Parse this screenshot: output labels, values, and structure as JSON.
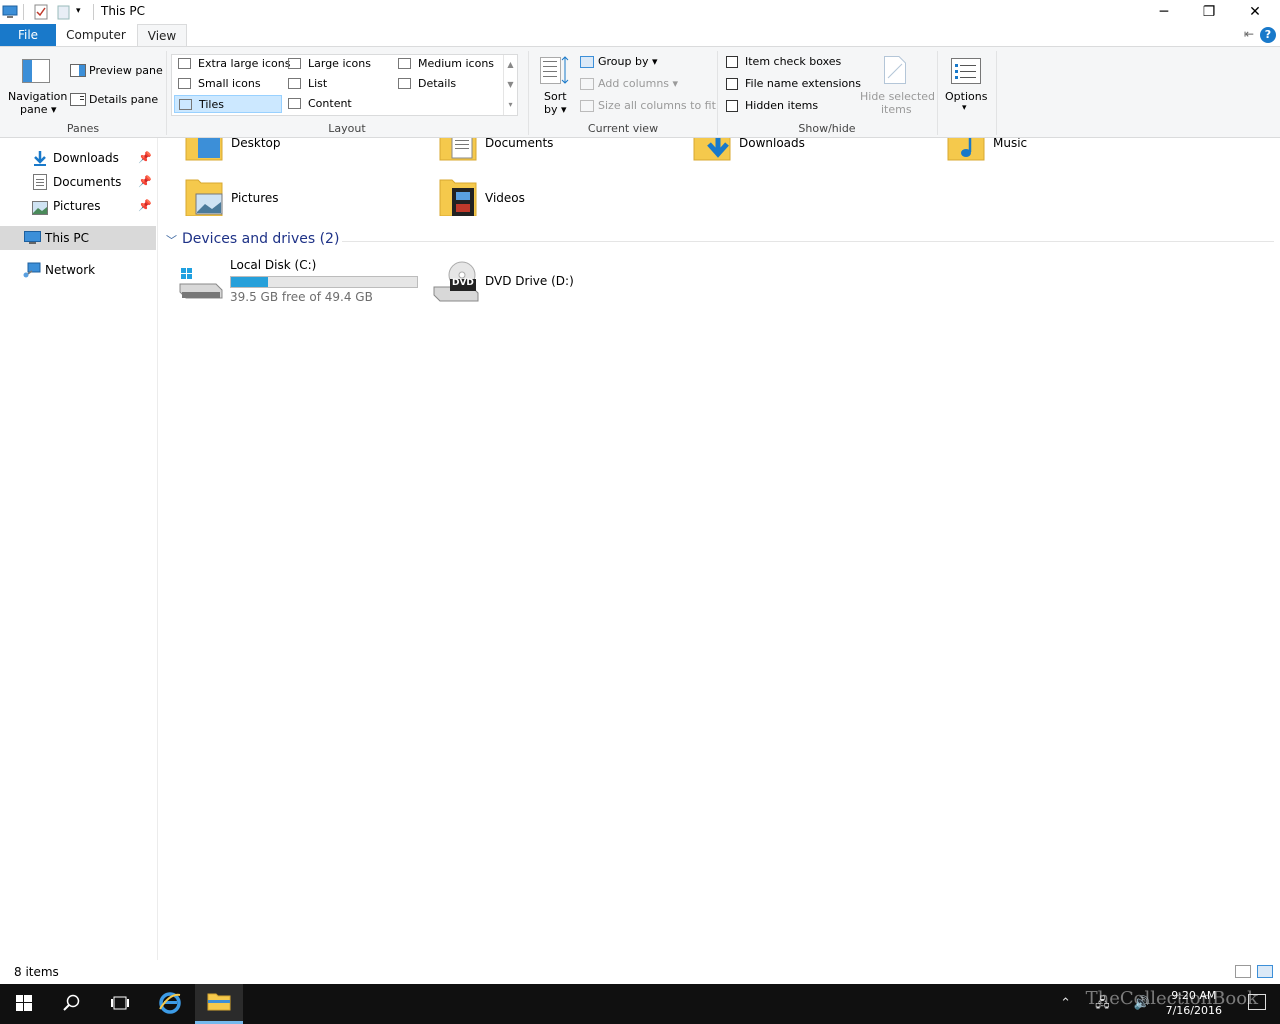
{
  "window": {
    "title": "This PC",
    "controls": {
      "minimize": "─",
      "maximize": "❐",
      "close": "✕"
    }
  },
  "tabs": [
    {
      "label": "File"
    },
    {
      "label": "Computer"
    },
    {
      "label": "View"
    }
  ],
  "ribbon": {
    "panes": {
      "navigation_pane": "Navigation",
      "navigation_pane2": "pane ▾",
      "preview_pane": "Preview pane",
      "details_pane": "Details pane",
      "group_label": "Panes"
    },
    "layout": {
      "items": [
        {
          "label": "Extra large icons"
        },
        {
          "label": "Large icons"
        },
        {
          "label": "Medium icons"
        },
        {
          "label": "Small icons"
        },
        {
          "label": "List"
        },
        {
          "label": "Details"
        },
        {
          "label": "Tiles"
        },
        {
          "label": "Content"
        }
      ],
      "selected": "Tiles",
      "group_label": "Layout"
    },
    "current_view": {
      "sort_by": "Sort",
      "sort_by2": "by ▾",
      "group_by": "Group by ▾",
      "add_columns": "Add columns ▾",
      "size_columns": "Size all columns to fit",
      "group_label": "Current view"
    },
    "show_hide": {
      "item_check_boxes": "Item check boxes",
      "file_name_extensions": "File name extensions",
      "hidden_items": "Hidden items",
      "hide_selected": "Hide selected",
      "hide_selected2": "items",
      "group_label": "Show/hide"
    },
    "options": {
      "label": "Options",
      "arrow": "▾"
    }
  },
  "nav": {
    "items": [
      {
        "label": "Downloads",
        "pinned": true
      },
      {
        "label": "Documents",
        "pinned": true
      },
      {
        "label": "Pictures",
        "pinned": true
      },
      {
        "label": "This PC",
        "selected": true
      },
      {
        "label": "Network"
      }
    ],
    "pin_glyph": "📌"
  },
  "content": {
    "folders": [
      {
        "label": "Desktop"
      },
      {
        "label": "Documents"
      },
      {
        "label": "Downloads"
      },
      {
        "label": "Music"
      },
      {
        "label": "Pictures"
      },
      {
        "label": "Videos"
      }
    ],
    "devices_header": "Devices and drives (2)",
    "drives": [
      {
        "label": "Local Disk (C:)",
        "sub": "39.5 GB free of 49.4 GB",
        "used_fraction": 0.2
      },
      {
        "label": "DVD Drive (D:)",
        "badge": "DVD"
      }
    ]
  },
  "status": {
    "count": "8 items"
  },
  "taskbar": {
    "clock_time": "9:20 AM",
    "clock_date": "7/16/2016",
    "watermark": "TheCollectionBook"
  },
  "colors": {
    "accent": "#1979ca",
    "selection": "#cce8ff",
    "drive_bar": "#26a0da"
  }
}
